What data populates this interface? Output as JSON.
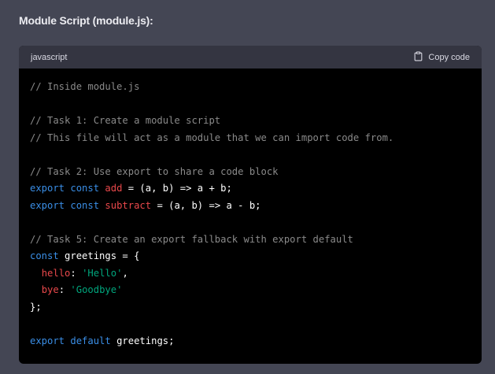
{
  "heading": "Module Script (module.js):",
  "code_block": {
    "language": "javascript",
    "copy_label": "Copy code",
    "icons": {
      "copy": "clipboard-icon"
    },
    "lines": [
      [
        {
          "t": "cm",
          "v": "// Inside module.js"
        }
      ],
      [],
      [
        {
          "t": "cm",
          "v": "// Task 1: Create a module script"
        }
      ],
      [
        {
          "t": "cm",
          "v": "// This file will act as a module that we can import code from."
        }
      ],
      [],
      [
        {
          "t": "cm",
          "v": "// Task 2: Use export to share a code block"
        }
      ],
      [
        {
          "t": "kw",
          "v": "export"
        },
        {
          "t": "pl",
          "v": " "
        },
        {
          "t": "kw",
          "v": "const"
        },
        {
          "t": "pl",
          "v": " "
        },
        {
          "t": "fn",
          "v": "add"
        },
        {
          "t": "pl",
          "v": " = (a, b) => a + b;"
        }
      ],
      [
        {
          "t": "kw",
          "v": "export"
        },
        {
          "t": "pl",
          "v": " "
        },
        {
          "t": "kw",
          "v": "const"
        },
        {
          "t": "pl",
          "v": " "
        },
        {
          "t": "fn",
          "v": "subtract"
        },
        {
          "t": "pl",
          "v": " = (a, b) => a - b;"
        }
      ],
      [],
      [
        {
          "t": "cm",
          "v": "// Task 5: Create an export fallback with export default"
        }
      ],
      [
        {
          "t": "kw",
          "v": "const"
        },
        {
          "t": "pl",
          "v": " greetings = {"
        }
      ],
      [
        {
          "t": "pl",
          "v": "  "
        },
        {
          "t": "prop",
          "v": "hello"
        },
        {
          "t": "pl",
          "v": ": "
        },
        {
          "t": "str",
          "v": "'Hello'"
        },
        {
          "t": "pl",
          "v": ","
        }
      ],
      [
        {
          "t": "pl",
          "v": "  "
        },
        {
          "t": "prop",
          "v": "bye"
        },
        {
          "t": "pl",
          "v": ": "
        },
        {
          "t": "str",
          "v": "'Goodbye'"
        }
      ],
      [
        {
          "t": "pl",
          "v": "};"
        }
      ],
      [],
      [
        {
          "t": "kw",
          "v": "export"
        },
        {
          "t": "pl",
          "v": " "
        },
        {
          "t": "kw",
          "v": "default"
        },
        {
          "t": "pl",
          "v": " greetings;"
        }
      ]
    ]
  },
  "colors": {
    "background": "#444654",
    "header": "#343541",
    "code_bg": "#000000",
    "comment": "#8a8a8a",
    "keyword": "#3a8ee6",
    "identifier_red": "#e9484b",
    "string": "#00a67d"
  }
}
